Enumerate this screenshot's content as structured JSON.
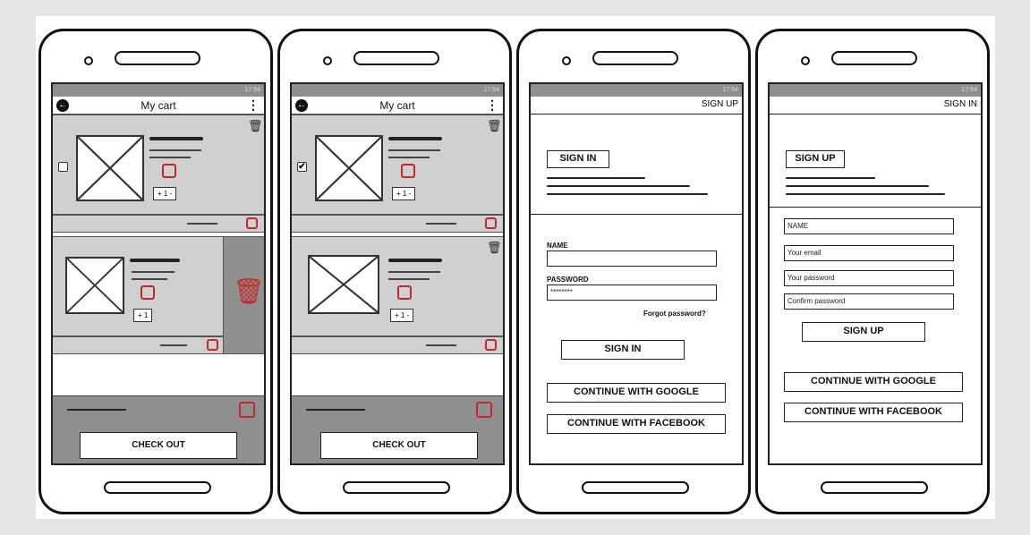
{
  "status": {
    "time": "17:54",
    "icons": "▾◢▮"
  },
  "cart": {
    "title": "My cart",
    "stepper_value": "+ 1 -",
    "stepper_value_short": "+ 1",
    "checkout_label": "CHECK OUT",
    "checked_mark": "✔",
    "delete_glyph": "🗑"
  },
  "signin_screen": {
    "header_link": "SIGN UP",
    "heading": "SIGN IN",
    "name_label": "NAME",
    "password_label": "PASSWORD",
    "password_value": "********",
    "forgot_label": "Forgot password?",
    "submit_label": "SIGN IN",
    "google_label": "CONTINUE WITH GOOGLE",
    "facebook_label": "CONTINUE WITH FACEBOOK"
  },
  "signup_screen": {
    "header_link": "SIGN IN",
    "heading": "SIGN UP",
    "name_placeholder": "NAME",
    "email_placeholder": "Your email",
    "password_placeholder": "Your password",
    "confirm_placeholder": "Confirm password",
    "submit_label": "SIGN UP",
    "google_label": "CONTINUE WITH GOOGLE",
    "facebook_label": "CONTINUE WITH FACEBOOK"
  },
  "colors": {
    "accent_red": "#c62828",
    "panel_gray": "#d0d0d0",
    "footer_gray": "#8f8f8f"
  }
}
